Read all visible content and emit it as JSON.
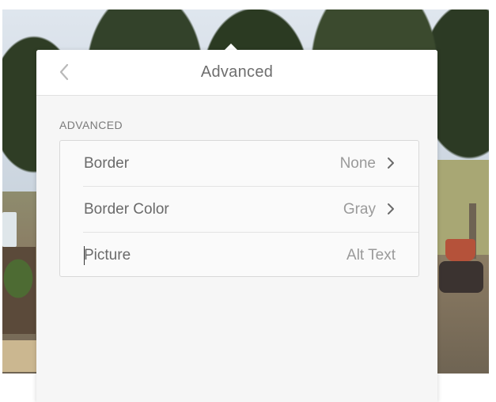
{
  "header": {
    "title": "Advanced",
    "back_icon": "chevron-left-icon"
  },
  "section": {
    "label": "ADVANCED"
  },
  "rows": [
    {
      "label": "Border",
      "value": "None",
      "icon": "chevron-right-icon"
    },
    {
      "label": "Border Color",
      "value": "Gray",
      "icon": "chevron-right-icon"
    },
    {
      "label": "Picture",
      "value": "Alt Text"
    }
  ],
  "colors": {
    "panel_bg": "#f6f6f6",
    "header_bg": "#ffffff",
    "text": "#6a6a6a",
    "muted": "#9a9a9a"
  }
}
